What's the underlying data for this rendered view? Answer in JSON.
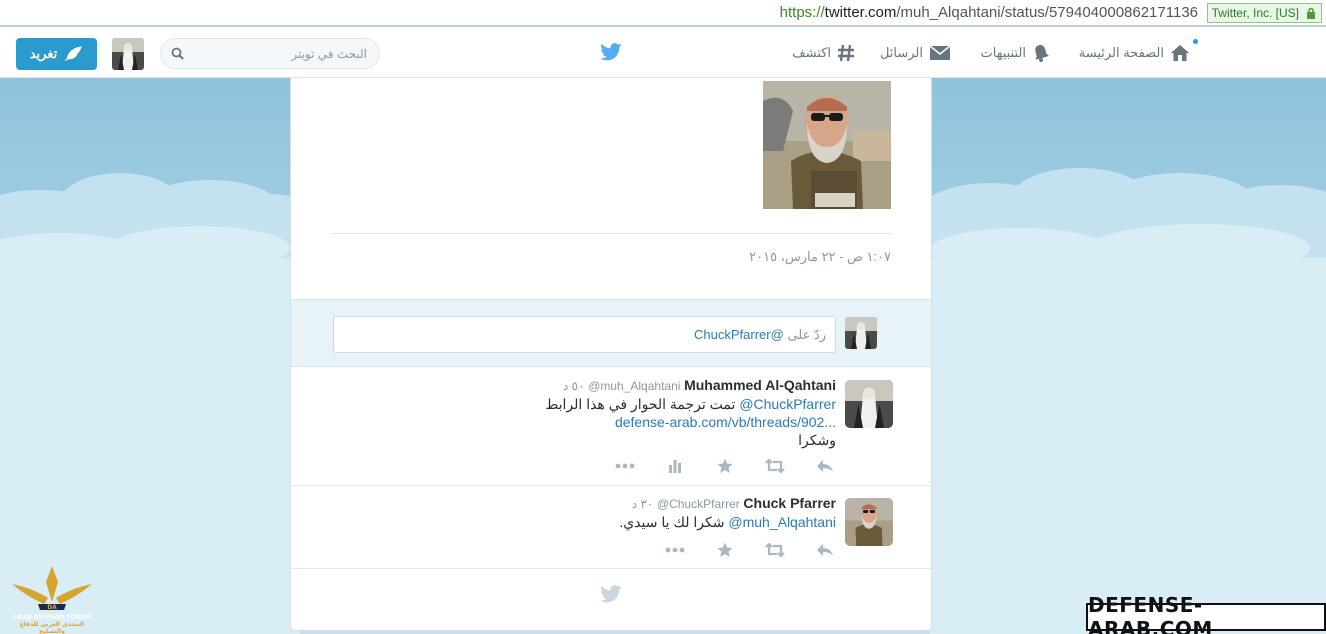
{
  "browser": {
    "url_scheme": "https://",
    "url_domain": "twitter.com",
    "url_path": "/muh_Alqahtani/status/579404000862171136",
    "cert_label": "Twitter, Inc. [US]"
  },
  "topbar": {
    "nav": {
      "home": "الصفحة الرئيسة",
      "notifications": "التنبيهات",
      "messages": "الرسائل",
      "discover": "اكتشف"
    },
    "search_placeholder": "البحث في تويتر",
    "tweet_button": "تغريد"
  },
  "main": {
    "timestamp": "١:٠٧ ص - ٢٢ مارس، ٢٠١٥",
    "reply": {
      "prefix": "ردّ على ",
      "mention": "@ChuckPfarrer"
    }
  },
  "replies": [
    {
      "name": "Muhammed Al-Qahtani",
      "handle": "@muh_Alqahtani",
      "time": "٥٠ د",
      "mention": "@ChuckPfarrer",
      "text_line1": " تمت ترجمة الحوار في هذا الرابط",
      "link": "defense-arab.com/vb/threads/902...",
      "text_line3": "وشكرا"
    },
    {
      "name": "Chuck Pfarrer",
      "handle": "@ChuckPfarrer",
      "time": "٣٠ د",
      "mention": "@muh_Alqahtani",
      "text": " شكرا لك يا سيدي."
    }
  ],
  "watermarks": {
    "left_brand": "ARAB DEFENSE FORUM",
    "left_sub": "المنتدى العربي للدفاع والتسليح",
    "right": "DEFENSE-ARAB.COM"
  },
  "colors": {
    "brand_blue": "#1da1f2",
    "button_blue": "#2b9acf",
    "link": "#2b7bb9",
    "background_sky": "#b5d9ea"
  }
}
